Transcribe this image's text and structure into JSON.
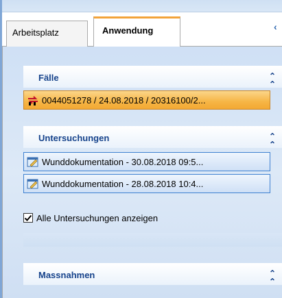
{
  "tabs": [
    {
      "label": "Arbeitsplatz",
      "active": false
    },
    {
      "label": "Anwendung",
      "active": true
    }
  ],
  "accent": "#f2a33a",
  "groups": {
    "faelle": {
      "title": "Fälle",
      "items": [
        {
          "icon": "case-arrows-icon",
          "text": "0044051278 / 24.08.2018 / 20316100/2..."
        }
      ]
    },
    "untersuchungen": {
      "title": "Untersuchungen",
      "items": [
        {
          "icon": "document-edit-icon",
          "text": "Wunddokumentation - 30.08.2018 09:5..."
        },
        {
          "icon": "document-edit-icon",
          "text": "Wunddokumentation - 28.08.2018 10:4..."
        }
      ],
      "show_all_label": "Alle Untersuchungen anzeigen",
      "show_all_checked": true
    },
    "massnahmen": {
      "title": "Massnahmen"
    }
  }
}
